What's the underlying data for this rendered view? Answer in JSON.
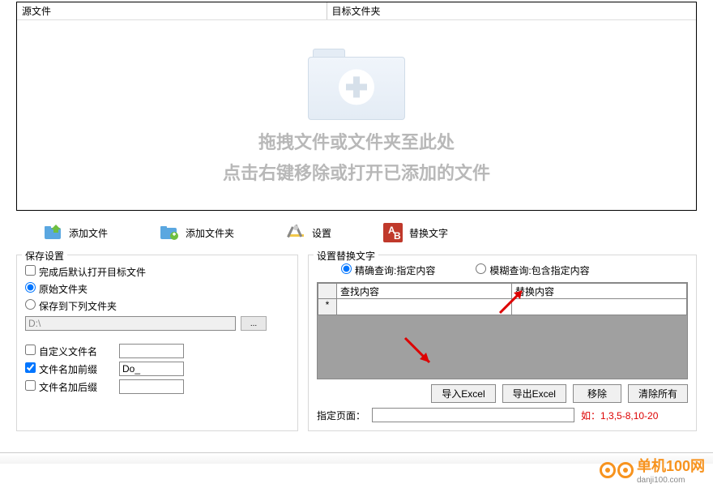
{
  "drop": {
    "col_source": "源文件",
    "col_target": "目标文件夹",
    "hint1": "拖拽文件或文件夹至此处",
    "hint2": "点击右键移除或打开已添加的文件"
  },
  "toolbar": {
    "add_file": "添加文件",
    "add_folder": "添加文件夹",
    "settings": "设置",
    "replace_text": "替换文字"
  },
  "save": {
    "legend": "保存设置",
    "open_after_done": "完成后默认打开目标文件",
    "original_folder": "原始文件夹",
    "save_to_folder": "保存到下列文件夹",
    "path": "D:\\",
    "custom_filename": "自定义文件名",
    "prefix": "文件名加前缀",
    "prefix_val": "Do_",
    "suffix": "文件名加后缀",
    "suffix_val": ""
  },
  "replace": {
    "legend": "设置替换文字",
    "exact": "精确查询:指定内容",
    "fuzzy": "模糊查询:包含指定内容",
    "col_find": "查找内容",
    "col_replace": "替换内容",
    "row_marker": "*",
    "import": "导入Excel",
    "export": "导出Excel",
    "remove": "移除",
    "clear_all": "清除所有",
    "page_label": "指定页面：",
    "page_hint": "如：1,3,5-8,10-20"
  },
  "watermark": {
    "name": "单机100网",
    "url": "danji100.com"
  }
}
